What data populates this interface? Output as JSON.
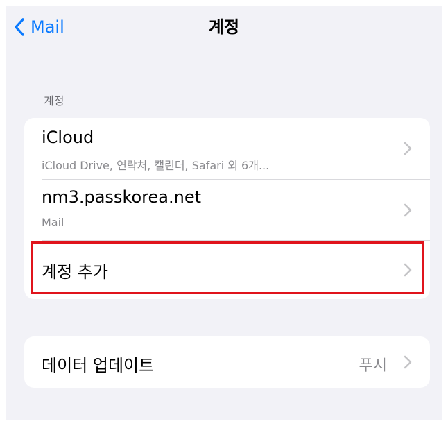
{
  "nav": {
    "back_label": "Mail",
    "title": "계정"
  },
  "accounts_section": {
    "header": "계정",
    "items": [
      {
        "title": "iCloud",
        "subtitle": "iCloud Drive, 연락처, 캘린더, Safari 외 6개..."
      },
      {
        "title": "nm3.passkorea.net",
        "subtitle": "Mail"
      },
      {
        "title": "계정 추가"
      }
    ]
  },
  "fetch_section": {
    "label": "데이터 업데이트",
    "value": "푸시"
  },
  "colors": {
    "accent": "#0a7aff",
    "background": "#f2f2f7",
    "highlight": "#e0141c",
    "secondary_text": "#8a8a8e"
  },
  "icons": {
    "back": "chevron-left-icon",
    "disclosure": "chevron-right-icon"
  }
}
